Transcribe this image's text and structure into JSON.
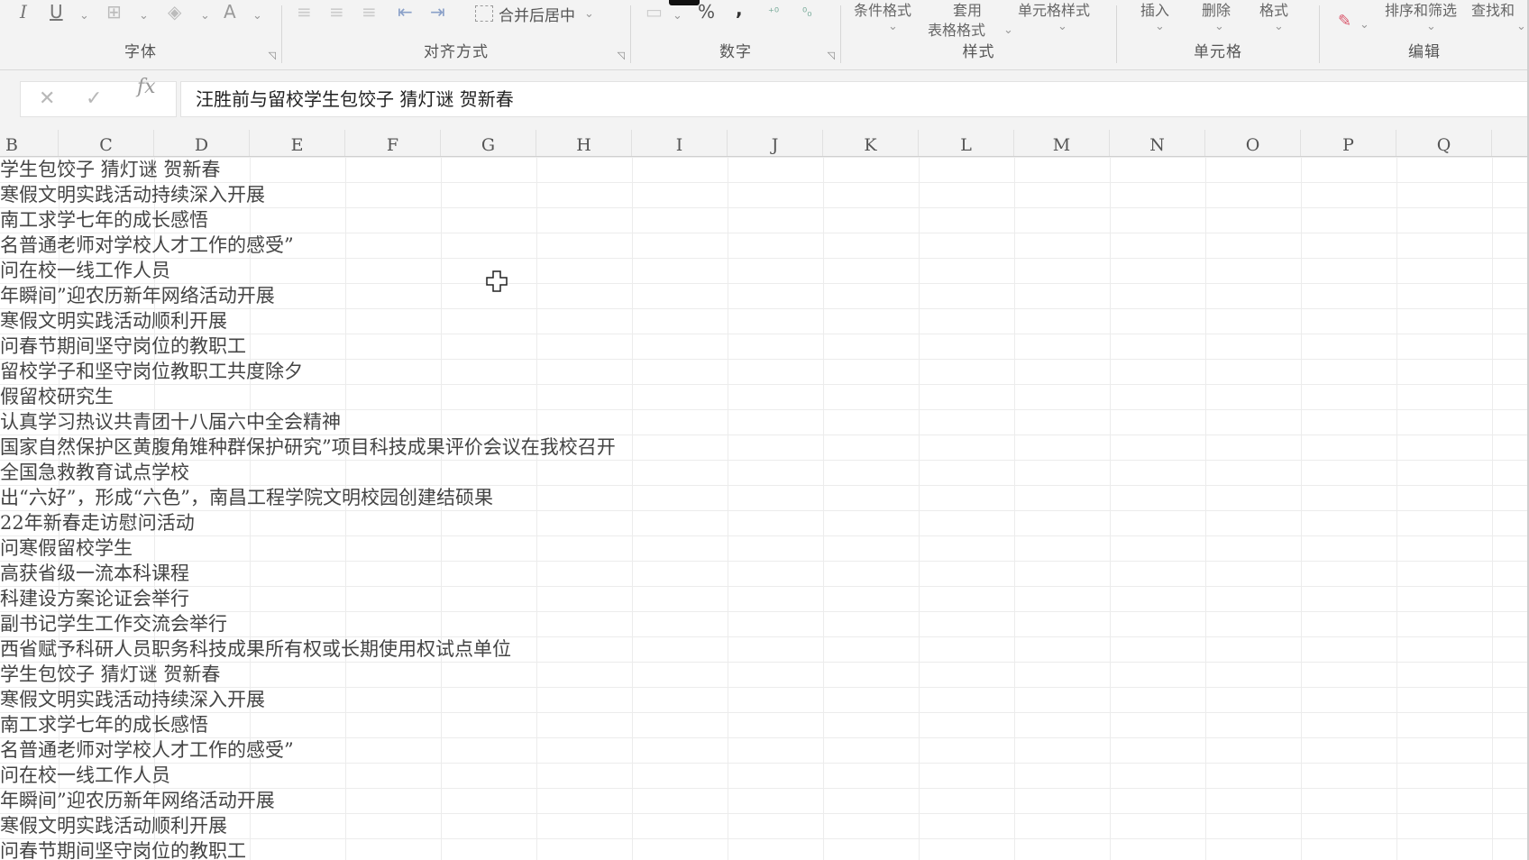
{
  "ribbon": {
    "groups": {
      "font": "字体",
      "alignment": "对齐方式",
      "number": "数字",
      "styles": "样式",
      "cells": "单元格",
      "editing": "编辑"
    },
    "font_tools": {
      "italic": "I",
      "underline": "U",
      "font_color": "A"
    },
    "merge_center": "合并后居中",
    "percent": "%",
    "comma": ",",
    "styles_tools": {
      "conditional_format": "条件格式",
      "table_format_top": "套用",
      "table_format_bottom": "表格格式",
      "cell_style": "单元格样式"
    },
    "cells_tools": {
      "insert": "插入",
      "delete": "删除",
      "format": "格式"
    },
    "editing_tools": {
      "sort_filter": "排序和筛选",
      "find_select": "查找和"
    }
  },
  "formula_bar": {
    "cancel": "✕",
    "enter": "✓",
    "fx": "fx",
    "value": "汪胜前与留校学生包饺子 猜灯谜 贺新春"
  },
  "columns": [
    "B",
    "C",
    "D",
    "E",
    "F",
    "G",
    "H",
    "I",
    "J",
    "K",
    "L",
    "M",
    "N",
    "O",
    "P",
    "Q"
  ],
  "rows": [
    "学生包饺子  猜灯谜  贺新春",
    "寒假文明实践活动持续深入开展",
    "南工求学七年的成长感悟",
    "名普通老师对学校人才工作的感受”",
    "问在校一线工作人员",
    "年瞬间”迎农历新年网络活动开展",
    "寒假文明实践活动顺利开展",
    "问春节期间坚守岗位的教职工",
    "留校学子和坚守岗位教职工共度除夕",
    "假留校研究生",
    "认真学习热议共青团十八届六中全会精神",
    "国家自然保护区黄腹角雉种群保护研究”项目科技成果评价会议在我校召开",
    "全国急救教育试点学校",
    "出“六好”，形成“六色”，南昌工程学院文明校园创建结硕果",
    "22年新春走访慰问活动",
    "问寒假留校学生",
    "高获省级一流本科课程",
    "科建设方案论证会举行",
    "副书记学生工作交流会举行",
    "西省赋予科研人员职务科技成果所有权或长期使用权试点单位",
    "学生包饺子  猜灯谜  贺新春",
    "寒假文明实践活动持续深入开展",
    "南工求学七年的成长感悟",
    "名普通老师对学校人才工作的感受”",
    "问在校一线工作人员",
    "年瞬间”迎农历新年网络活动开展",
    "寒假文明实践活动顺利开展",
    "问春节期间坚守岗位的教职工"
  ]
}
